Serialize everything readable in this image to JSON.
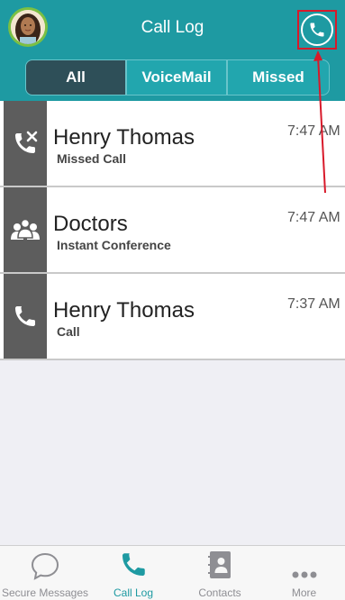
{
  "header": {
    "title": "Call Log",
    "avatar_icon": "user-avatar",
    "call_icon": "phone-icon"
  },
  "segments": [
    {
      "label": "All",
      "selected": true
    },
    {
      "label": "VoiceMail",
      "selected": false
    },
    {
      "label": "Missed",
      "selected": false
    }
  ],
  "calls": [
    {
      "name": "Henry Thomas",
      "type": "Missed Call",
      "time": "7:47 AM",
      "icon": "missed-call-icon"
    },
    {
      "name": "Doctors",
      "type": "Instant Conference",
      "time": "7:47 AM",
      "icon": "group-icon"
    },
    {
      "name": "Henry Thomas",
      "type": "Call",
      "time": "7:37 AM",
      "icon": "phone-icon"
    }
  ],
  "tabs": [
    {
      "label": "Secure Messages",
      "icon": "chat-bubble-icon",
      "active": false
    },
    {
      "label": "Call Log",
      "icon": "phone-icon",
      "active": true
    },
    {
      "label": "Contacts",
      "icon": "contacts-book-icon",
      "active": false
    },
    {
      "label": "More",
      "icon": "more-dots-icon",
      "active": false
    }
  ],
  "colors": {
    "brand_teal": "#1e9aa2",
    "segment_selected": "#2e4f58",
    "annotation_red": "#d8192a",
    "row_icon_bg": "#5d5d5d"
  }
}
